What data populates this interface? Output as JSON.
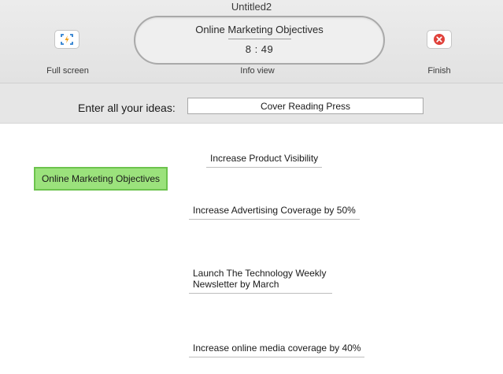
{
  "window": {
    "title": "Untitled2"
  },
  "toolbar": {
    "full_screen": {
      "label": "Full screen",
      "icon": "full-screen-icon"
    },
    "info_view": {
      "label": "Info view",
      "title": "Online Marketing Objectives",
      "timer": "8 : 49"
    },
    "finish": {
      "label": "Finish",
      "icon": "finish-icon"
    }
  },
  "entry": {
    "label": "Enter all your ideas:",
    "value": "Cover Reading Press"
  },
  "map": {
    "central_topic": "Online Marketing Objectives",
    "ideas": [
      "Increase Product Visibility",
      "Increase Advertising Coverage by 50%",
      "Launch The Technology Weekly Newsletter by March",
      "Increase online media coverage by 40%"
    ]
  },
  "colors": {
    "central_fill": "#9be27c",
    "central_border": "#6cc34d",
    "finish_icon": "#e0413a",
    "full_screen_icon_bracket": "#2d7fd0",
    "full_screen_icon_bolt": "#f3a21c"
  }
}
